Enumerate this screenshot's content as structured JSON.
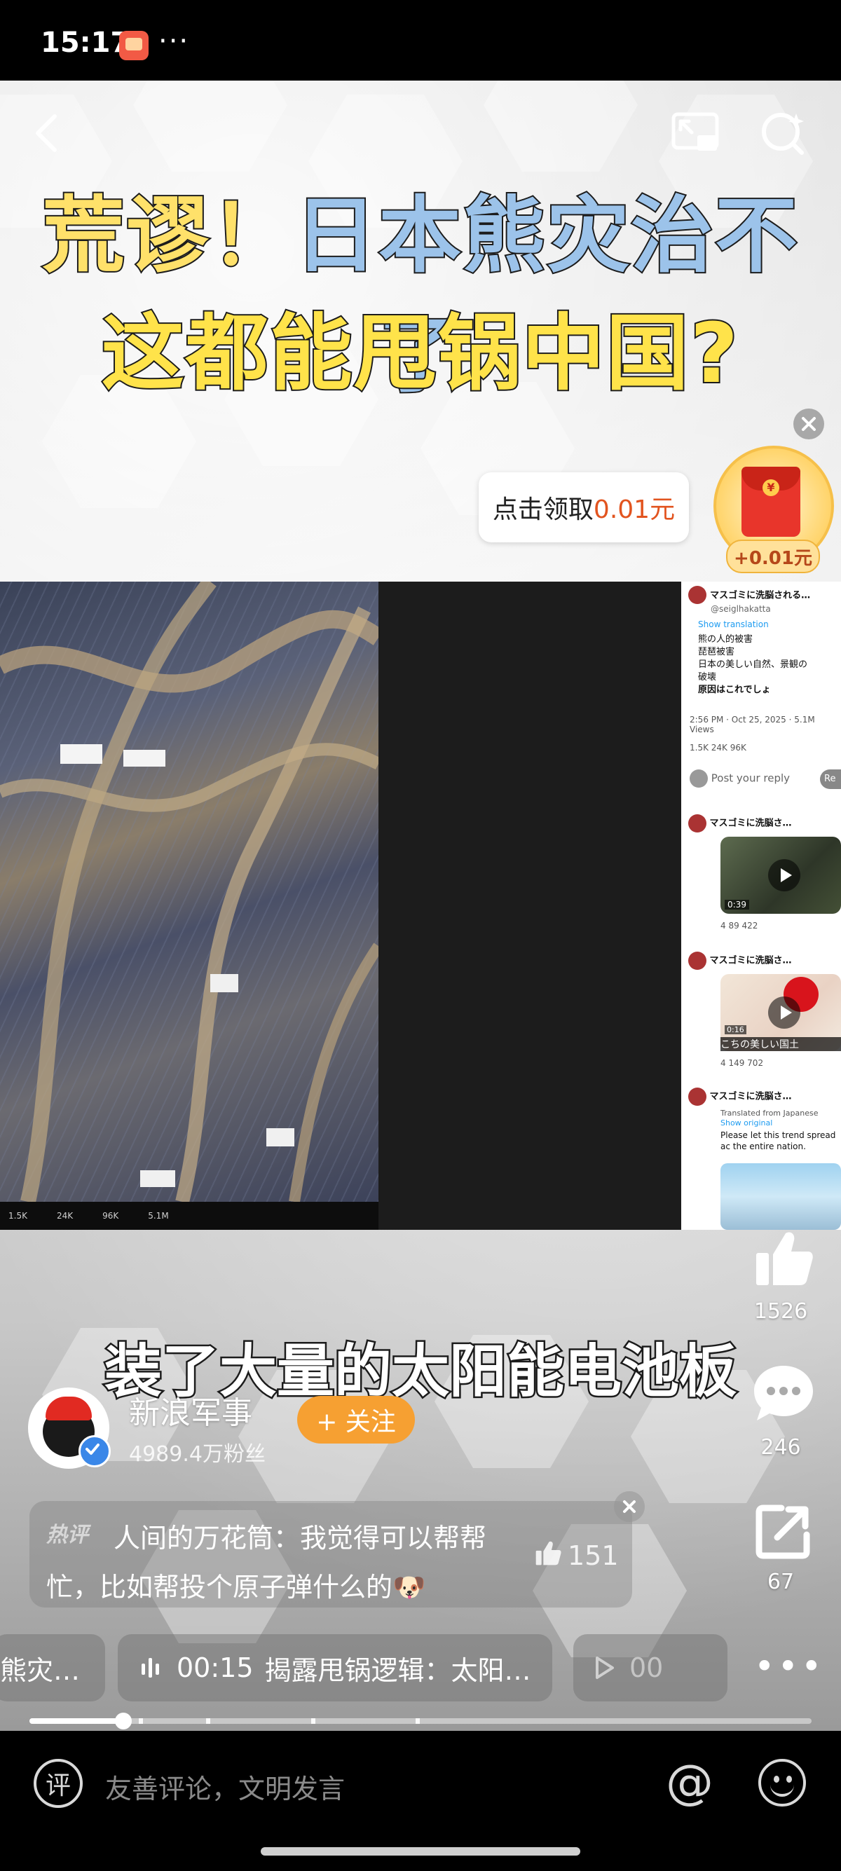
{
  "status_bar": {
    "time": "15:17",
    "more": "···"
  },
  "video": {
    "title_line1_a": "荒谬！",
    "title_line1_b": "日本熊灾治不了",
    "title_line2": "这都能甩锅中国?",
    "subtitle": "装了大量的太阳能电池板"
  },
  "red_packet": {
    "prompt": "点击领取",
    "amount": "0.01元",
    "reward_badge": "+0.01元"
  },
  "embedded": {
    "photo_stats": [
      "1.5K",
      "24K",
      "96K",
      "5.1M"
    ],
    "tweet_author": "マスゴミに洗脳される…",
    "tweet_handle": "@seiglhakatta",
    "tweet_translate": "Show translation",
    "tweet_lines": [
      "熊の人的被害",
      "琵琶被害",
      "日本の美しい自然、景観の",
      "破壊",
      "原因はこれでしょ"
    ],
    "tweet_time": "2:56 PM · Oct 25, 2025 · 5.1M Views",
    "tweet_actions": "1.5K   24K   96K",
    "reply_placeholder": "Post your reply",
    "reply_btn": "Re",
    "reply1_name": "マスゴミに洗脳さ…",
    "reply1_time": "0:39",
    "reply1_stats": "4   89   422",
    "reply2_name": "マスゴミに洗脳さ…",
    "reply2_time": "0:16",
    "reply2_caption": "こちの美しい国土",
    "reply2_stats": "4   149   702",
    "reply3_name": "マスゴミに洗脳さ…",
    "reply3_translated": "Translated from Japanese",
    "reply3_show": "Show original",
    "reply3_text": "Please let this trend spread ac the entire nation."
  },
  "actions": {
    "likes": "1526",
    "comments": "246",
    "shares": "67"
  },
  "author": {
    "name": "新浪军事",
    "fans": "4989.4万粉丝",
    "follow_label": "+ 关注"
  },
  "hot_comment": {
    "tag": "热评",
    "text": "人间的万花筒：我觉得可以帮帮忙，比如帮投个原子弹什么的🐶",
    "likes": "151"
  },
  "chapters": {
    "prev": "熊灾…",
    "current_time": "00:15",
    "current_title": "揭露甩锅逻辑：太阳…",
    "next": "00"
  },
  "progress": {
    "fraction": 0.12,
    "marks": [
      0.14,
      0.226,
      0.36,
      0.494
    ]
  },
  "input": {
    "placeholder": "友善评论，文明发言",
    "comment_glyph": "评"
  }
}
